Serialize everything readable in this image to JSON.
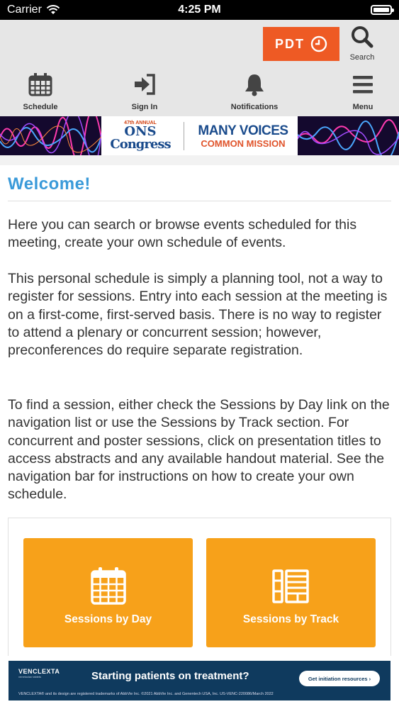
{
  "status_bar": {
    "carrier": "Carrier",
    "time": "4:25 PM"
  },
  "header": {
    "timezone": "PDT",
    "search_label": "Search"
  },
  "nav": [
    {
      "label": "Schedule",
      "icon": "calendar-icon"
    },
    {
      "label": "Sign In",
      "icon": "sign-in-icon"
    },
    {
      "label": "Notifications",
      "icon": "bell-icon"
    },
    {
      "label": "Menu",
      "icon": "hamburger-icon"
    }
  ],
  "banner": {
    "annual": "47th ANNUAL",
    "ons": "ONS",
    "congress": "Congress",
    "tagline_top": "MANY VOICES",
    "tagline_bottom": "COMMON MISSION"
  },
  "welcome": {
    "title": "Welcome!",
    "p1": "Here you can search or browse events scheduled for this meeting, create your own schedule of events.",
    "p2": "This personal schedule is simply a planning tool, not a way to register for sessions. Entry into each session at the meeting is on a first-come, first-served basis. There is no way to register to attend a plenary or concurrent session; however, preconferences do require separate registration.",
    "p3": "To find a session, either check the Sessions by Day link on the navigation list or use the Sessions by Track section. For concurrent and poster sessions, click on presentation titles to access abstracts and any available handout material. See the navigation bar for instructions on how to create your own schedule."
  },
  "tiles": [
    {
      "label": "Sessions by Day",
      "icon": "calendar-icon"
    },
    {
      "label": "Sessions by Track",
      "icon": "track-list-icon"
    }
  ],
  "ad": {
    "brand": "VENCLEXTA",
    "brand_sub": "venetoclax tablets",
    "headline": "Starting patients on treatment?",
    "button": "Get initiation resources ›",
    "fine_print": "VENCLEXTA® and its design are registered trademarks of AbbVie Inc. ©2021 AbbVie Inc. and Genentech USA, Inc. US-VENC-220086/March 2022"
  },
  "colors": {
    "accent_orange": "#f7a11a",
    "pdt_orange": "#ee5a24",
    "welcome_blue": "#3a9ad9",
    "header_gray": "#e6e6e6"
  }
}
